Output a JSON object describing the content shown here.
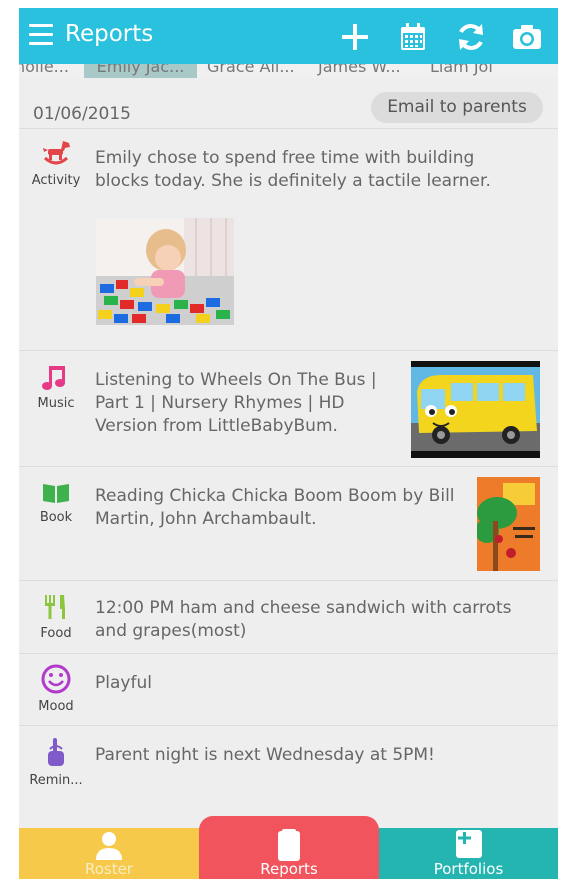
{
  "header": {
    "title": "Reports"
  },
  "roster_tabs": [
    {
      "label": "nolle..."
    },
    {
      "label": "Emily Jac..."
    },
    {
      "label": "Grace All..."
    },
    {
      "label": "James W..."
    },
    {
      "label": "Liam Joi"
    }
  ],
  "report": {
    "date": "01/06/2015",
    "email_button": "Email to parents",
    "entries": [
      {
        "category": "Activity",
        "text": "Emily chose to spend free time with building blocks today. She is definitely a tactile learner."
      },
      {
        "category": "Music",
        "text": "Listening to Wheels On The Bus | Part 1 | Nursery Rhymes | HD Version from LittleBabyBum."
      },
      {
        "category": "Book",
        "text": "Reading Chicka Chicka Boom Boom  by Bill Martin, John Archambault."
      },
      {
        "category": "Food",
        "text": "12:00 PM ham and cheese sandwich with carrots and grapes(most)"
      },
      {
        "category": "Mood",
        "text": "Playful"
      },
      {
        "category": "Remin...",
        "text": "Parent night is next Wednesday at 5PM!"
      }
    ]
  },
  "bottom_nav": [
    {
      "label": "Roster"
    },
    {
      "label": "Reports"
    },
    {
      "label": "Portfolios"
    }
  ],
  "colors": {
    "topbar": "#29c1dd",
    "roster_tab": "#f7c94a",
    "reports_tab": "#f1545c",
    "portfolios_tab": "#24b5b1",
    "activity_icon": "#e2464b",
    "music_icon": "#e63a87",
    "book_icon": "#3fb24d",
    "food_icon": "#8cc63e",
    "mood_icon": "#b23acb",
    "reminder_icon": "#7f5bc9"
  }
}
